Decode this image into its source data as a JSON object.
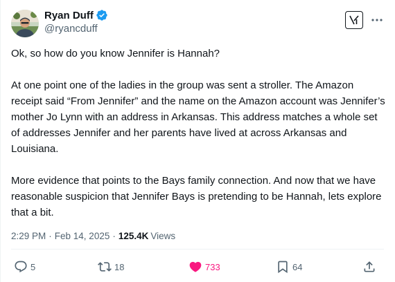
{
  "author": {
    "display_name": "Ryan Duff",
    "handle": "@ryancduff",
    "verified": true
  },
  "icons": {
    "avatar": "avatar",
    "verified": "verified-badge-icon",
    "grok": "grok-icon",
    "more": "more-icon",
    "reply": "reply-icon",
    "repost": "repost-icon",
    "like": "heart-icon",
    "bookmark": "bookmark-icon",
    "share": "share-icon"
  },
  "colors": {
    "verified": "#1d9bf0",
    "like": "#f91880",
    "secondary_text": "#536471",
    "primary_text": "#0f1419"
  },
  "tweet": {
    "paragraphs": [
      "Ok, so how do you know Jennifer is Hannah?",
      "At one point one of the ladies in the group was sent a stroller. The Amazon receipt said “From Jennifer” and the name on the Amazon account was Jennifer’s mother Jo Lynn with an address in Arkansas. This address matches a whole set of addresses Jennifer and her parents have lived at across Arkansas and Louisiana.",
      "More evidence that points to the Bays family connection. And now that we have reasonable suspicion that Jennifer Bays is pretending to be Hannah, lets explore that a bit."
    ],
    "time": "2:29 PM",
    "separator": "·",
    "date": "Feb 14, 2025",
    "views_count": "125.4K",
    "views_label": "Views"
  },
  "actions": {
    "replies": "5",
    "reposts": "18",
    "likes": "733",
    "bookmarks": "64"
  }
}
